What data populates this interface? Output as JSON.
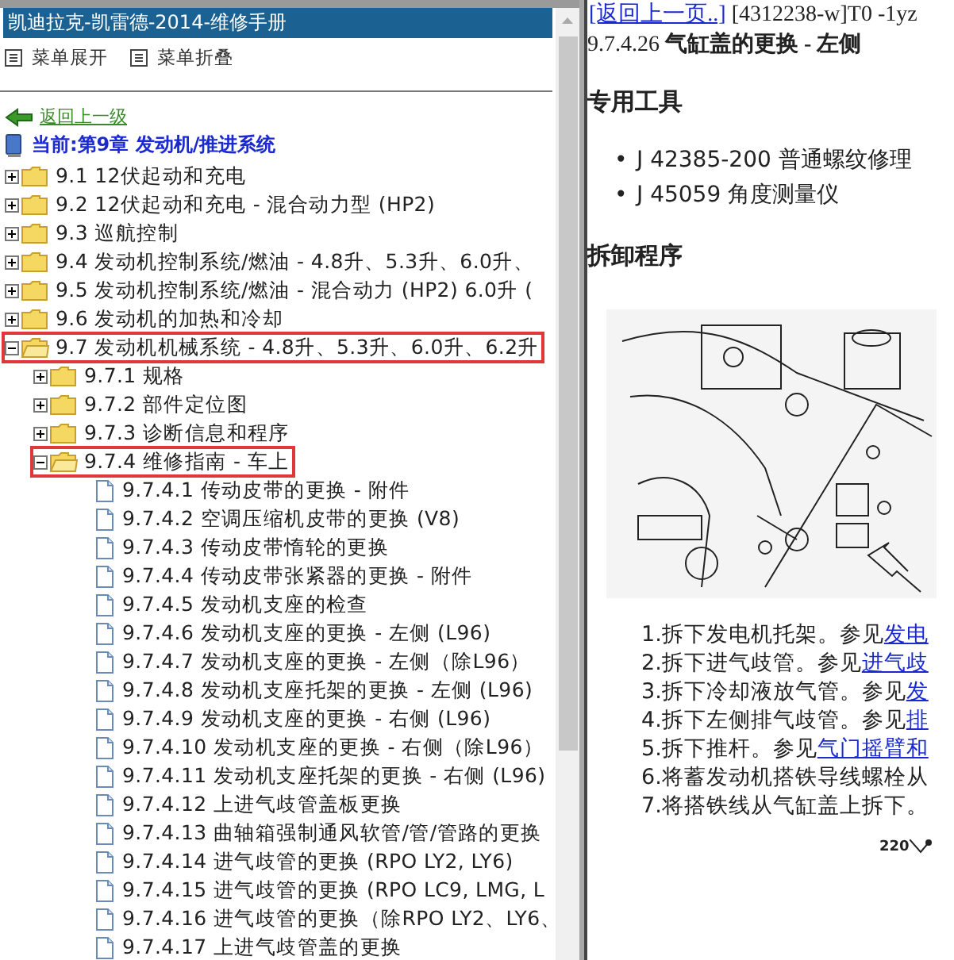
{
  "left_pane": {
    "title": "凯迪拉克-凯雷德-2014-维修手册",
    "toolbar": [
      {
        "label": "菜单展开"
      },
      {
        "label": "菜单折叠"
      }
    ],
    "back_link": "返回上一级",
    "current": "当前:第9章 发动机/推进系统",
    "tree": [
      {
        "kind": "folder",
        "label": "9.1 12伏起动和充电",
        "expanded": false,
        "highlighted": false
      },
      {
        "kind": "folder",
        "label": "9.2 12伏起动和充电 - 混合动力型 (HP2)",
        "expanded": false,
        "highlighted": false
      },
      {
        "kind": "folder",
        "label": "9.3 巡航控制",
        "expanded": false,
        "highlighted": false
      },
      {
        "kind": "folder",
        "label": "9.4 发动机控制系统/燃油 - 4.8升、5.3升、6.0升、",
        "expanded": false,
        "highlighted": false
      },
      {
        "kind": "folder",
        "label": "9.5 发动机控制系统/燃油 - 混合动力 (HP2) 6.0升 (",
        "expanded": false,
        "highlighted": false
      },
      {
        "kind": "folder",
        "label": "9.6 发动机的加热和冷却",
        "expanded": false,
        "highlighted": false
      },
      {
        "kind": "folder",
        "label": "9.7 发动机机械系统 - 4.8升、5.3升、6.0升、6.2升",
        "expanded": true,
        "highlighted": true,
        "children": [
          {
            "kind": "folder",
            "label": "9.7.1 规格",
            "expanded": false,
            "highlighted": false
          },
          {
            "kind": "folder",
            "label": "9.7.2 部件定位图",
            "expanded": false,
            "highlighted": false
          },
          {
            "kind": "folder",
            "label": "9.7.3 诊断信息和程序",
            "expanded": false,
            "highlighted": false
          },
          {
            "kind": "folder",
            "label": "9.7.4 维修指南 - 车上",
            "expanded": true,
            "highlighted": true,
            "children": [
              {
                "kind": "page",
                "label": "9.7.4.1 传动皮带的更换 - 附件"
              },
              {
                "kind": "page",
                "label": "9.7.4.2 空调压缩机皮带的更换 (V8)"
              },
              {
                "kind": "page",
                "label": "9.7.4.3 传动皮带惰轮的更换"
              },
              {
                "kind": "page",
                "label": "9.7.4.4 传动皮带张紧器的更换 - 附件"
              },
              {
                "kind": "page",
                "label": "9.7.4.5 发动机支座的检查"
              },
              {
                "kind": "page",
                "label": "9.7.4.6 发动机支座的更换 - 左侧 (L96)"
              },
              {
                "kind": "page",
                "label": "9.7.4.7 发动机支座的更换 - 左侧（除L96）"
              },
              {
                "kind": "page",
                "label": "9.7.4.8 发动机支座托架的更换 - 左侧 (L96)"
              },
              {
                "kind": "page",
                "label": "9.7.4.9 发动机支座的更换 - 右侧 (L96)"
              },
              {
                "kind": "page",
                "label": "9.7.4.10 发动机支座的更换 - 右侧（除L96）"
              },
              {
                "kind": "page",
                "label": "9.7.4.11 发动机支座托架的更换 - 右侧 (L96)"
              },
              {
                "kind": "page",
                "label": "9.7.4.12 上进气歧管盖板更换"
              },
              {
                "kind": "page",
                "label": "9.7.4.13 曲轴箱强制通风软管/管/管路的更换"
              },
              {
                "kind": "page",
                "label": "9.7.4.14 进气歧管的更换 (RPO LY2, LY6)"
              },
              {
                "kind": "page",
                "label": "9.7.4.15 进气歧管的更换 (RPO LC9, LMG, L"
              },
              {
                "kind": "page",
                "label": "9.7.4.16 进气歧管的更换（除RPO LY2、LY6、"
              },
              {
                "kind": "page",
                "label": "9.7.4.17 上进气歧管盖的更换"
              }
            ]
          }
        ]
      }
    ]
  },
  "right_pane": {
    "back_link": "[返回上一页..]",
    "doc_id": "[4312238-w]T0 -1yz",
    "number": "9.7.4.26",
    "title": "气缸盖的更换 - 左侧",
    "tools_heading": "专用工具",
    "tools": [
      {
        "bullet": "•",
        "text": "J 42385-200 普通螺纹修理"
      },
      {
        "bullet": "•",
        "text": "J 45059 角度测量仪"
      }
    ],
    "procedure_heading": "拆卸程序",
    "steps": [
      {
        "text": "1.拆下发电机托架。参见",
        "link": "发电"
      },
      {
        "text": "2.拆下进气歧管。参见",
        "link": "进气歧"
      },
      {
        "text": "3.拆下冷却液放气管。参见",
        "link": "发"
      },
      {
        "text": "4.拆下左侧排气歧管。参见",
        "link": "排"
      },
      {
        "text": "5.拆下推杆。参见",
        "link": "气门摇臂和"
      },
      {
        "text": "6.将蓄发动机搭铁导线螺栓从"
      },
      {
        "text": "7.将搭铁线从气缸盖上拆下。"
      }
    ],
    "callout": "220"
  }
}
